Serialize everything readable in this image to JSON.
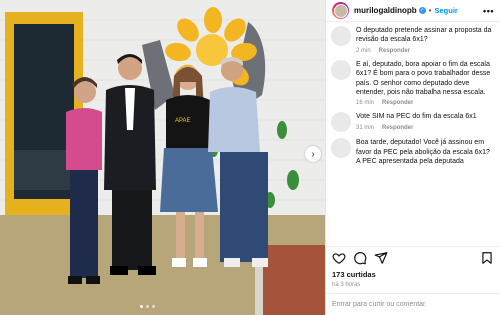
{
  "header": {
    "username": "murilogaldinopb",
    "follow_label": "Seguir",
    "separator": "•",
    "more_label": "•••"
  },
  "photo": {
    "banner_text": "APAE",
    "carousel_next": "›"
  },
  "comments": [
    {
      "text": "O deputado pretende assinar a proposta da revisão da escala 6x1?",
      "time": "2 min",
      "reply_label": "Responder"
    },
    {
      "text": "E aí, deputado, bora apoiar o fim da escala 6x1? É bom para o povo trabalhador desse país. O senhor como deputado deve entender, pois não trabalha nessa escala.",
      "time": "16 min",
      "reply_label": "Responder"
    },
    {
      "text": "Vote SIM na PEC do fim da escala 6x1",
      "time": "31 min",
      "reply_label": "Responder"
    },
    {
      "text": "Boa tarde, deputado! Você já assinou em favor da PEC pela abolição da escala 6x1? A PEC apresentada pela deputada",
      "time": "",
      "reply_label": ""
    }
  ],
  "post": {
    "likes": "173 curtidas",
    "posted": "há 3 horas",
    "comment_placeholder": "Entrar para curtir ou comentar."
  },
  "icons": {
    "like": "heart-icon",
    "comment": "comment-icon",
    "share": "send-icon",
    "save": "bookmark-icon"
  },
  "colors": {
    "follow": "#0095f6",
    "verified": "#3897f0",
    "meta": "#8e8e8e"
  }
}
